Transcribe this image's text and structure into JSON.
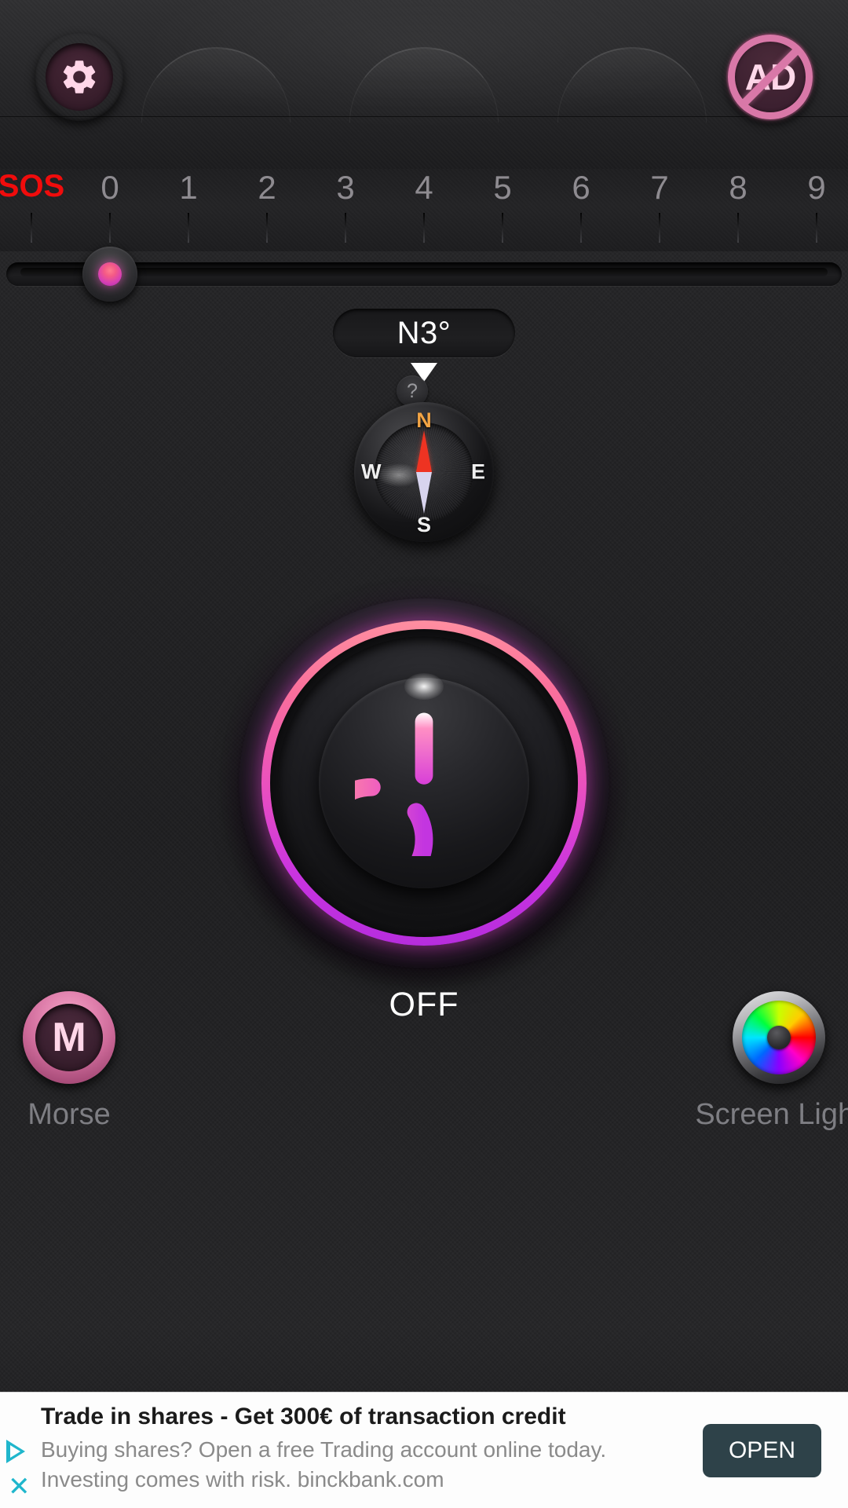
{
  "header": {
    "settings_icon": "gear-icon",
    "adblock_label": "AD",
    "adblock_icon": "no-ads-icon"
  },
  "scale": {
    "labels": [
      "SOS",
      "0",
      "1",
      "2",
      "3",
      "4",
      "5",
      "6",
      "7",
      "8",
      "9"
    ],
    "sos_color": "#f00c0c",
    "label_color": "#8e8b90",
    "selected_index": 1,
    "selected_value": "0"
  },
  "compass": {
    "heading_text": "N3°",
    "help_label": "?",
    "north": "N",
    "east": "E",
    "south": "S",
    "west": "W",
    "north_color": "#f2a444",
    "needle_north_color": "#ee3322",
    "needle_south_color": "#d8d4ee"
  },
  "power": {
    "state_label": "OFF",
    "glow_top_color": "#ff8ea0",
    "glow_bottom_color": "#b62ddd",
    "icon": "power-icon"
  },
  "bottom": {
    "morse": {
      "badge": "M",
      "label": "Morse",
      "icon": "morse-icon"
    },
    "screen_light": {
      "label": "Screen Light",
      "icon": "color-wheel-icon"
    }
  },
  "ad": {
    "title": "Trade in shares - Get 300€ of transaction credit",
    "line1": "Buying shares? Open a free Trading account online today.",
    "line2": "Investing comes with risk. binckbank.com",
    "button_label": "OPEN",
    "accent_color": "#1fb6cc",
    "button_bg": "#2e4249"
  }
}
